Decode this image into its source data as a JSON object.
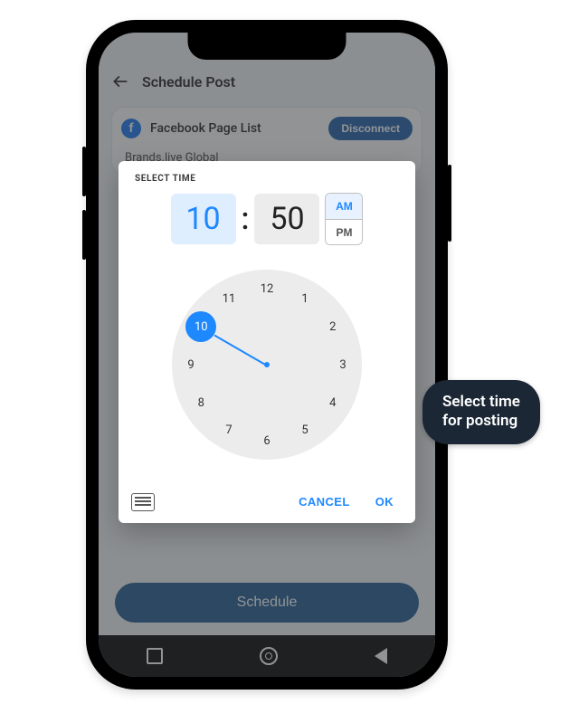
{
  "header": {
    "title": "Schedule Post"
  },
  "fb_card": {
    "label": "Facebook Page List",
    "disconnect": "Disconnect",
    "page_name": "Brands.live Global"
  },
  "schedule_button": "Schedule",
  "dialog": {
    "title": "SELECT TIME",
    "hour": "10",
    "minute": "50",
    "am": "AM",
    "pm": "PM",
    "selected_period": "AM",
    "selected_hour": 10,
    "cancel": "CANCEL",
    "ok": "OK"
  },
  "callout": {
    "line1": "Select time",
    "line2": "for posting"
  },
  "clock_numbers": [
    "12",
    "1",
    "2",
    "3",
    "4",
    "5",
    "6",
    "7",
    "8",
    "9",
    "10",
    "11"
  ]
}
